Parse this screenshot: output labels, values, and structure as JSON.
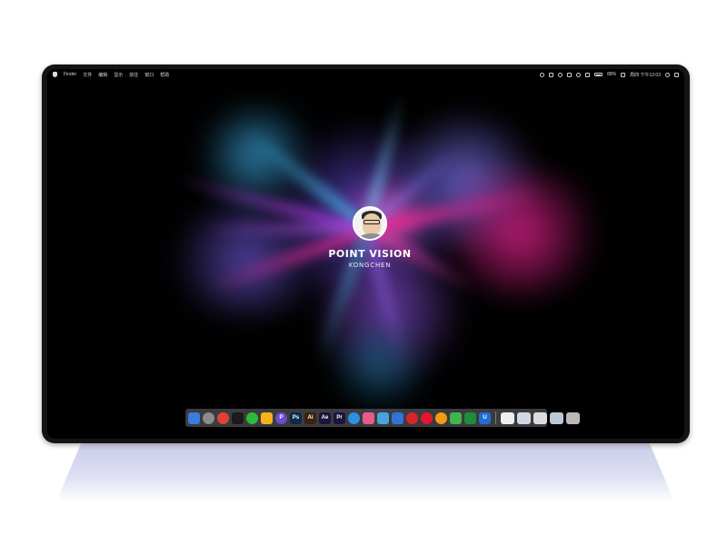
{
  "menubar": {
    "app_name": "Finder",
    "menus": [
      "文件",
      "编辑",
      "显示",
      "前往",
      "窗口",
      "帮助"
    ],
    "clock": "周四 下午12:03",
    "battery": "88%"
  },
  "profile": {
    "title": "POINT VISION",
    "subtitle": "KONGCHEN"
  },
  "dock": {
    "apps": [
      {
        "name": "finder-icon",
        "label": "",
        "color": "#3a7be0"
      },
      {
        "name": "launchpad-icon",
        "label": "",
        "color": "#8c8c8c"
      },
      {
        "name": "chrome-icon",
        "label": "",
        "color": "#e34133"
      },
      {
        "name": "qq-icon",
        "label": "",
        "color": "#1b1b1b"
      },
      {
        "name": "wechat-icon",
        "label": "",
        "color": "#2dbb3a"
      },
      {
        "name": "sketch-icon",
        "label": "",
        "color": "#f6b21b"
      },
      {
        "name": "pp-icon",
        "label": "P",
        "color": "#6c4ccc"
      },
      {
        "name": "photoshop-icon",
        "label": "Ps",
        "color": "#0d2b4a"
      },
      {
        "name": "illustrator-icon",
        "label": "Ai",
        "color": "#3a2110"
      },
      {
        "name": "after-effects-icon",
        "label": "Ae",
        "color": "#1d1240"
      },
      {
        "name": "premiere-icon",
        "label": "Pr",
        "color": "#1d1240"
      },
      {
        "name": "safari-icon",
        "label": "",
        "color": "#2f8fe0"
      },
      {
        "name": "photos-icon",
        "label": "",
        "color": "#e85a8a"
      },
      {
        "name": "chart-icon",
        "label": "",
        "color": "#4aa3df"
      },
      {
        "name": "keynote-icon",
        "label": "",
        "color": "#2f74d6"
      },
      {
        "name": "netease-music-icon",
        "label": "",
        "color": "#d7262a"
      },
      {
        "name": "weibo-icon",
        "label": "",
        "color": "#e6162d"
      },
      {
        "name": "orange-app-icon",
        "label": "",
        "color": "#f39c12"
      },
      {
        "name": "wechat-work-icon",
        "label": "",
        "color": "#3fb54a"
      },
      {
        "name": "green-app-icon",
        "label": "",
        "color": "#1e8c3a"
      },
      {
        "name": "shield-icon",
        "label": "U",
        "color": "#1f6fd1"
      }
    ],
    "docs": [
      {
        "name": "document-icon",
        "color": "#eeeeee"
      },
      {
        "name": "screenshot-icon",
        "color": "#cfd8e3"
      },
      {
        "name": "folder-doc-icon",
        "color": "#dcdcdc"
      },
      {
        "name": "preview-icon",
        "color": "#b9c7d6"
      },
      {
        "name": "trash-icon",
        "color": "#b8b8b8"
      }
    ]
  }
}
